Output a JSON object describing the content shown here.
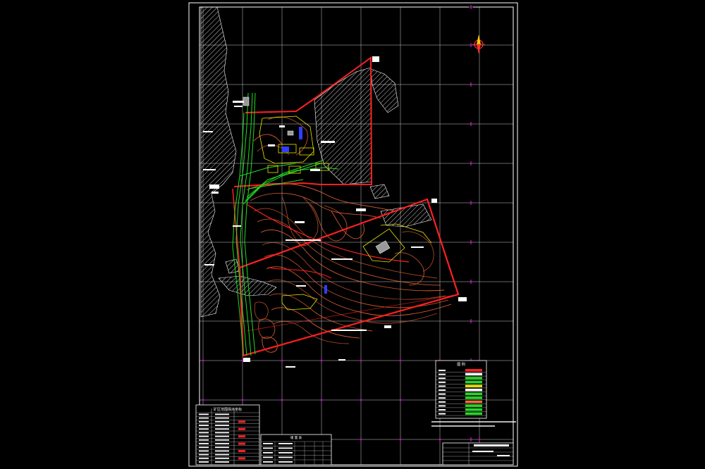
{
  "colors": {
    "background": "#000000",
    "frame": "#ffffff",
    "grid": "#ffffff",
    "grid_marker": "#cc33cc",
    "boundary": "#ff2020",
    "contour": "#ff6a3a",
    "road": "#22dd22",
    "building": "#e8e800",
    "hatch": "#ffffff",
    "blue": "#2f3fff"
  },
  "icons": {
    "north_arrow": "north-arrow-icon"
  },
  "legend": {
    "title": "图 例",
    "rows": 12
  },
  "parameter_table": {
    "title": "矿区范围拐点坐标",
    "rows": 14
  },
  "reserve_table": {
    "title": "储 量 表",
    "rows": 5
  },
  "title_block": {
    "rows": 4
  }
}
